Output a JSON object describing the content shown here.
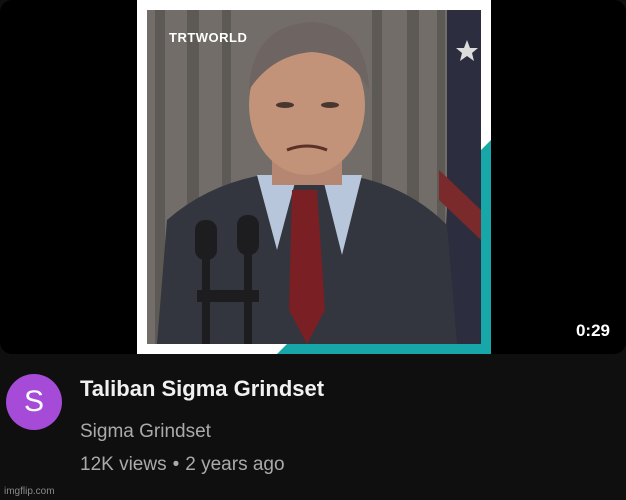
{
  "video": {
    "brand_watermark": "TRTWORLD",
    "duration": "0:29",
    "thumbnail_description_icon": "video-thumbnail"
  },
  "channel": {
    "avatar_letter": "S",
    "avatar_color": "#a64ad8",
    "name": "Sigma Grindset"
  },
  "details": {
    "title": "Taliban Sigma Grindset",
    "views": "12K views",
    "separator": "•",
    "age": "2 years ago"
  },
  "footer": {
    "watermark": "imgflip.com"
  },
  "colors": {
    "background": "#0f0f0f",
    "accent_teal": "#17a7a8",
    "title_text": "#f1f1f1",
    "secondary_text": "#aaaaaa"
  }
}
